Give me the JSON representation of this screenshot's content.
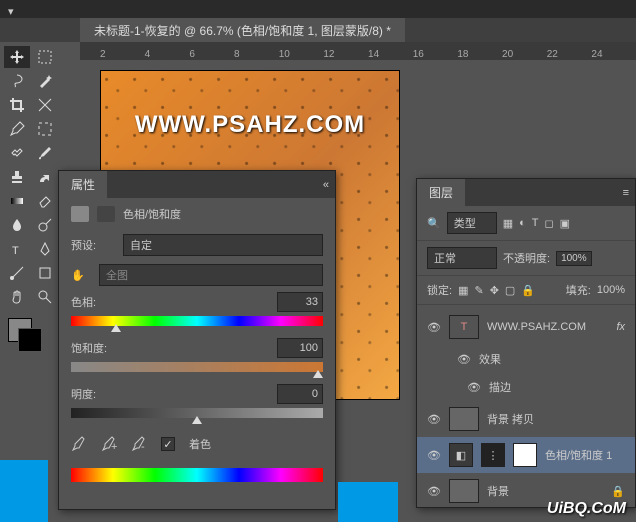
{
  "doc": {
    "title": "未标题-1-恢复的 @ 66.7% (色相/饱和度 1, 图层蒙版/8) *"
  },
  "ruler": {
    "marks": [
      "2",
      "4",
      "6",
      "8",
      "10",
      "12",
      "14",
      "16",
      "18",
      "20",
      "22",
      "24"
    ]
  },
  "canvas": {
    "watermark_text": "WWW.PSAHZ.COM"
  },
  "props": {
    "panel_title": "属性",
    "adjust_name": "色相/饱和度",
    "preset_label": "预设:",
    "preset_value": "自定",
    "channel_value": "全图",
    "hue": {
      "label": "色相:",
      "value": "33"
    },
    "saturation": {
      "label": "饱和度:",
      "value": "100"
    },
    "lightness": {
      "label": "明度:",
      "value": "0"
    },
    "colorize_label": "着色"
  },
  "layers": {
    "panel_title": "图层",
    "filter_label": "类型",
    "blend_mode": "正常",
    "opacity_label": "不透明度:",
    "opacity_value": "100%",
    "lock_label": "锁定:",
    "fill_label": "填充:",
    "fill_value": "100%",
    "items": {
      "text": {
        "name": "WWW.PSAHZ.COM",
        "fx": "fx"
      },
      "effects": "效果",
      "stroke": "描边",
      "copy": "背景 拷贝",
      "adjust": "色相/饱和度 1",
      "bg": "背景"
    }
  },
  "watermark": "UiBQ.CoM"
}
